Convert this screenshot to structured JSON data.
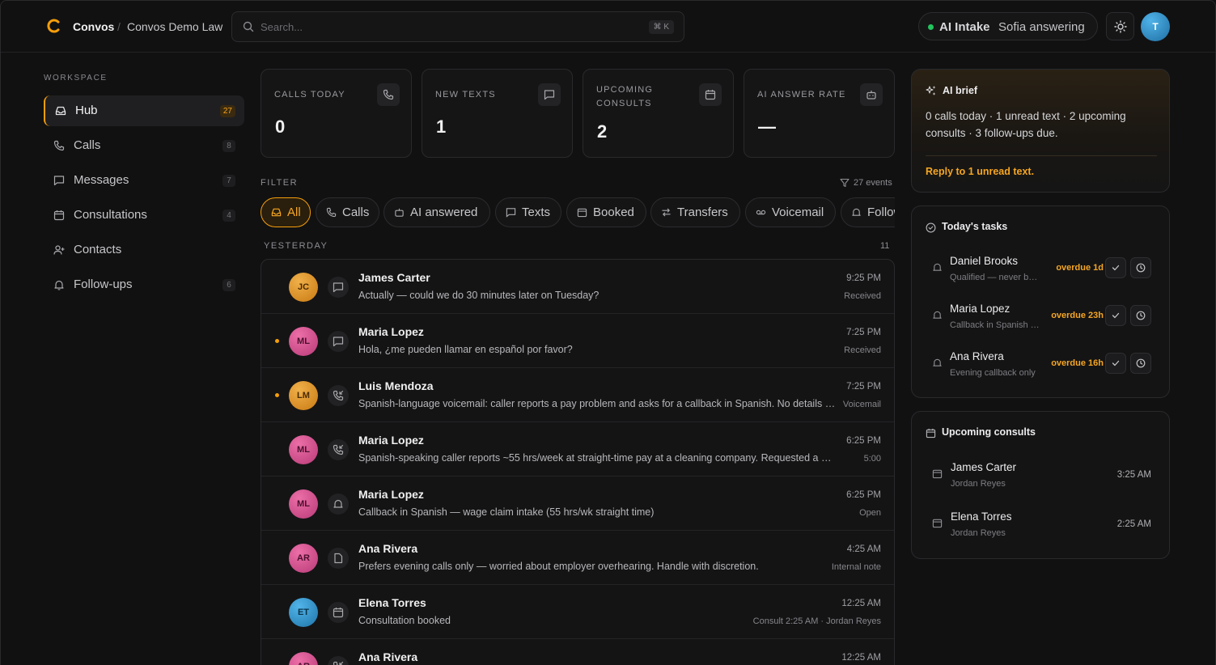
{
  "header": {
    "brand": "Convos",
    "separator": "/",
    "org": "Convos Demo Law",
    "search_placeholder": "Search...",
    "shortcut": "⌘ K",
    "ai_label": "AI Intake",
    "ai_status": "Sofia answering",
    "user_initial": "T"
  },
  "sidebar": {
    "section_label": "WORKSPACE",
    "items": [
      {
        "label": "Hub",
        "count": "27",
        "icon": "inbox-icon"
      },
      {
        "label": "Calls",
        "count": "8",
        "icon": "phone-icon"
      },
      {
        "label": "Messages",
        "count": "7",
        "icon": "message-icon"
      },
      {
        "label": "Consultations",
        "count": "4",
        "icon": "calendar-icon"
      },
      {
        "label": "Contacts",
        "count": "",
        "icon": "user-plus-icon"
      },
      {
        "label": "Follow-ups",
        "count": "6",
        "icon": "bell-icon"
      }
    ]
  },
  "stats": [
    {
      "label": "CALLS TODAY",
      "value": "0",
      "icon": "phone-icon"
    },
    {
      "label": "NEW TEXTS",
      "value": "1",
      "icon": "message-icon"
    },
    {
      "label": "UPCOMING CONSULTS",
      "value": "2",
      "icon": "calendar-icon"
    },
    {
      "label": "AI ANSWER RATE",
      "value": "—",
      "icon": "bot-icon"
    }
  ],
  "filter": {
    "label": "FILTER",
    "events": "27 events",
    "chips": [
      "All",
      "Calls",
      "AI answered",
      "Texts",
      "Booked",
      "Transfers",
      "Voicemail",
      "Follow-ups"
    ]
  },
  "feed": {
    "day_label": "YESTERDAY",
    "day_count": "11",
    "rows": [
      {
        "initials": "JC",
        "name": "James Carter",
        "message": "Actually — could we do 30 minutes later on Tuesday?",
        "time": "9:25 PM",
        "status": "Received",
        "unread": false,
        "color": "orange",
        "type": "message-icon"
      },
      {
        "initials": "ML",
        "name": "Maria Lopez",
        "message": "Hola, ¿me pueden llamar en español por favor?",
        "time": "7:25 PM",
        "status": "Received",
        "unread": true,
        "color": "pink",
        "type": "message-icon"
      },
      {
        "initials": "LM",
        "name": "Luis Mendoza",
        "message": "Spanish-language voicemail: caller reports a pay problem and asks for a callback in Spanish. No details given.",
        "time": "7:25 PM",
        "status": "Voicemail",
        "unread": true,
        "color": "orange",
        "type": "phone-incoming-icon"
      },
      {
        "initials": "ML",
        "name": "Maria Lopez",
        "message": "Spanish-speaking caller reports ~55 hrs/week at straight-time pay at a cleaning company. Requested a Spanish callback.",
        "time": "6:25 PM",
        "status": "5:00",
        "unread": false,
        "color": "pink",
        "type": "phone-incoming-icon"
      },
      {
        "initials": "ML",
        "name": "Maria Lopez",
        "message": "Callback in Spanish — wage claim intake (55 hrs/wk straight time)",
        "time": "6:25 PM",
        "status": "Open",
        "unread": false,
        "color": "pink",
        "type": "bell-icon"
      },
      {
        "initials": "AR",
        "name": "Ana Rivera",
        "message": "Prefers evening calls only — worried about employer overhearing. Handle with discretion.",
        "time": "4:25 AM",
        "status": "Internal note",
        "unread": false,
        "color": "pink",
        "type": "note-icon"
      },
      {
        "initials": "ET",
        "name": "Elena Torres",
        "message": "Consultation booked",
        "time": "12:25 AM",
        "status": "Consult 2:25 AM · Jordan Reyes",
        "unread": false,
        "color": "blue",
        "type": "calendar-icon"
      },
      {
        "initials": "AR",
        "name": "Ana Rivera",
        "message": "",
        "time": "12:25 AM",
        "status": "",
        "unread": false,
        "color": "pink",
        "type": "phone-incoming-icon"
      }
    ]
  },
  "brief": {
    "title": "AI brief",
    "text": "0 calls today · 1 unread text · 2 upcoming consults · 3 follow-ups due.",
    "action": "Reply to 1 unread text."
  },
  "tasks": {
    "title": "Today's tasks",
    "items": [
      {
        "name": "Daniel Brooks",
        "sub": "Qualified — never booked",
        "due": "overdue 1d"
      },
      {
        "name": "Maria Lopez",
        "sub": "Callback in Spanish — wage claim",
        "due": "overdue 23h"
      },
      {
        "name": "Ana Rivera",
        "sub": "Evening callback only",
        "due": "overdue 16h"
      }
    ]
  },
  "consults": {
    "title": "Upcoming consults",
    "items": [
      {
        "name": "James Carter",
        "attorney": "Jordan Reyes",
        "time": "3:25 AM"
      },
      {
        "name": "Elena Torres",
        "attorney": "Jordan Reyes",
        "time": "2:25 AM"
      }
    ]
  },
  "colors": {
    "accent": "#f59e0b",
    "online": "#22c55e",
    "background": "#111112"
  }
}
